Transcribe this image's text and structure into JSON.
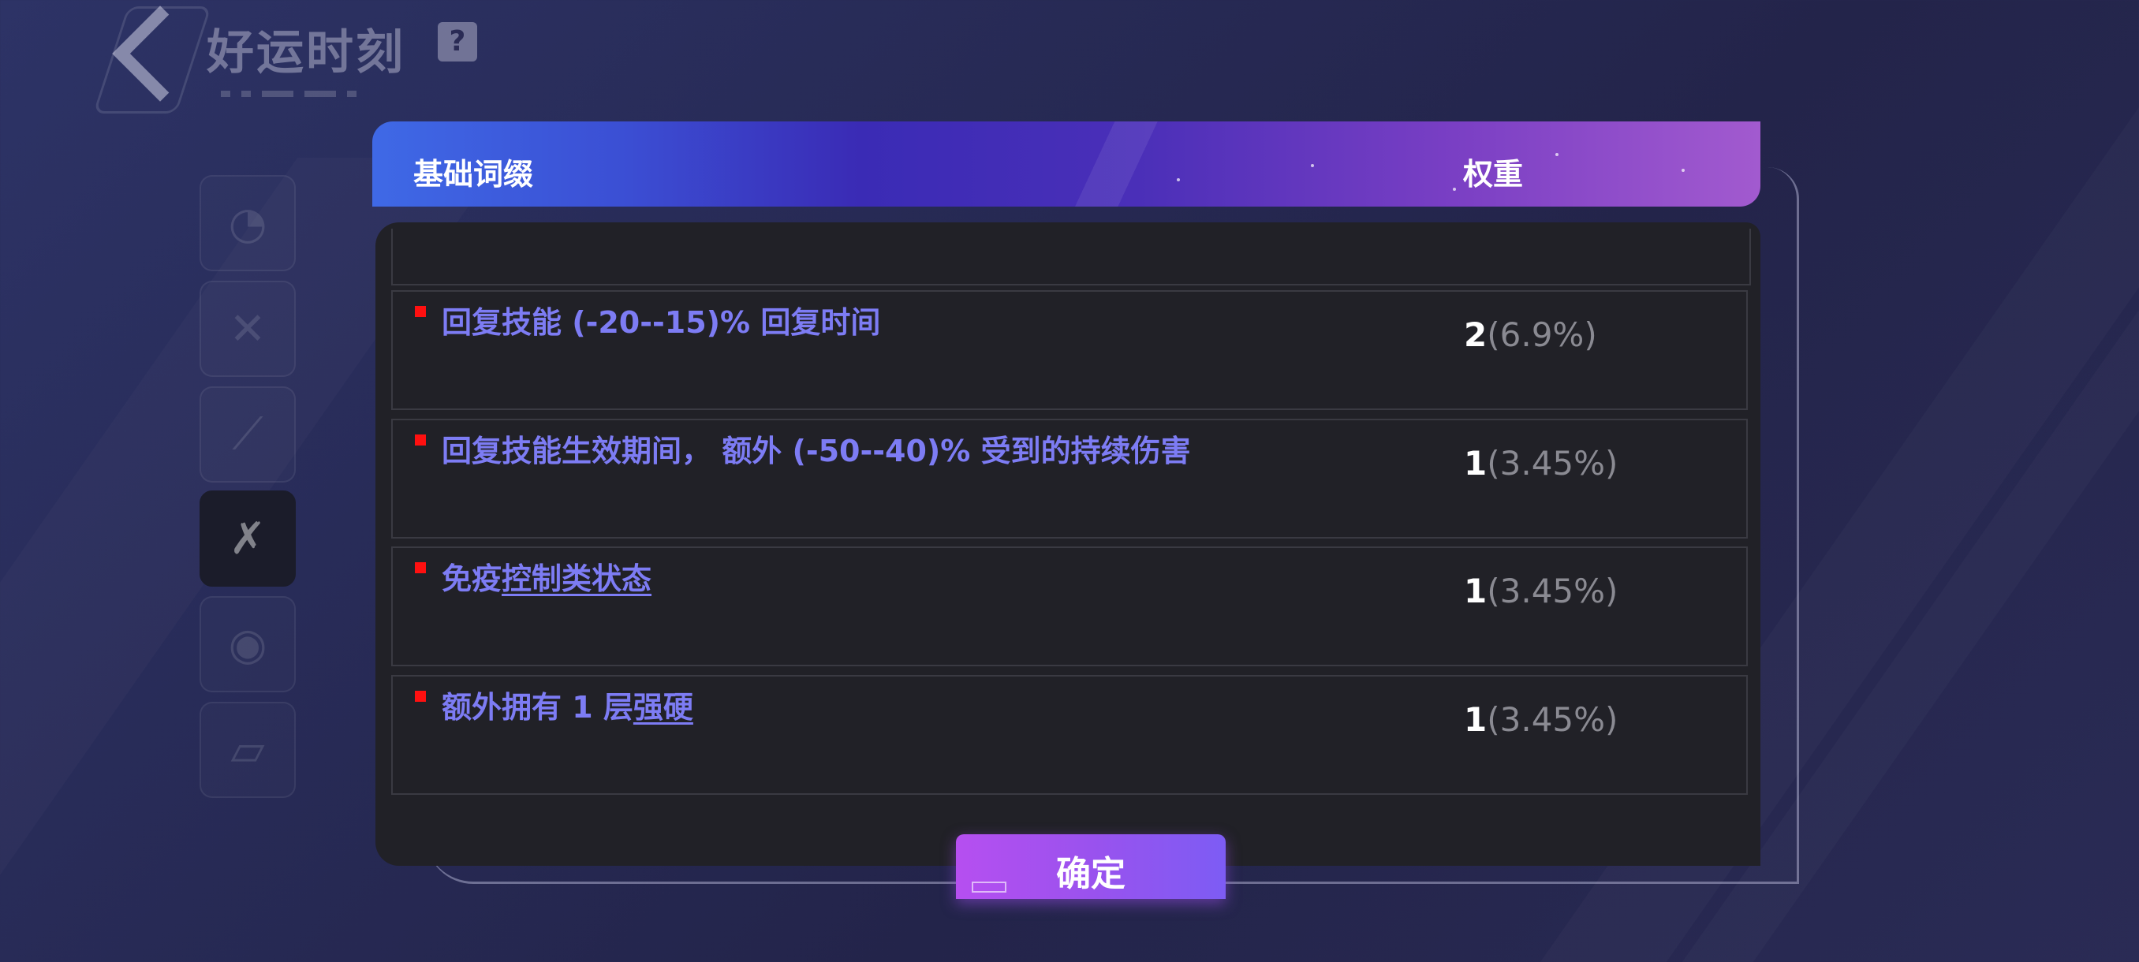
{
  "header": {
    "title": "好运时刻",
    "help_label": "?"
  },
  "colors": {
    "accent_purple": "#7d7cf4",
    "bullet_red": "#ff1010",
    "button_gradient_start": "#b64ff0",
    "button_gradient_end": "#7d5cf4"
  },
  "side_tabs": [
    {
      "icon": "swirl-icon",
      "glyph": "◔"
    },
    {
      "icon": "sword-cross-icon",
      "glyph": "✕"
    },
    {
      "icon": "sword-slash-icon",
      "glyph": "⟋"
    },
    {
      "icon": "sword-crossed-active-icon",
      "glyph": "✗"
    },
    {
      "icon": "vortex-icon",
      "glyph": "◉"
    },
    {
      "icon": "card-icon",
      "glyph": "▱"
    }
  ],
  "table": {
    "col_affix": "基础词缀",
    "col_weight": "权重",
    "rows": [
      {
        "parts": [
          {
            "t": "回复技能 (-20--15)% 回复时间",
            "u": false
          }
        ],
        "weight": "2",
        "pct": "(6.9%)"
      },
      {
        "parts": [
          {
            "t": "回复技能生效期间， 额外 (-50--40)% 受到的持续伤害",
            "u": false
          }
        ],
        "weight": "1",
        "pct": "(3.45%)"
      },
      {
        "parts": [
          {
            "t": "免疫",
            "u": false
          },
          {
            "t": "控制类状态",
            "u": true
          }
        ],
        "weight": "1",
        "pct": "(3.45%)"
      },
      {
        "parts": [
          {
            "t": "额外拥有 1 层",
            "u": false
          },
          {
            "t": "强硬",
            "u": true
          }
        ],
        "weight": "1",
        "pct": "(3.45%)"
      }
    ]
  },
  "confirm_label": "确定"
}
